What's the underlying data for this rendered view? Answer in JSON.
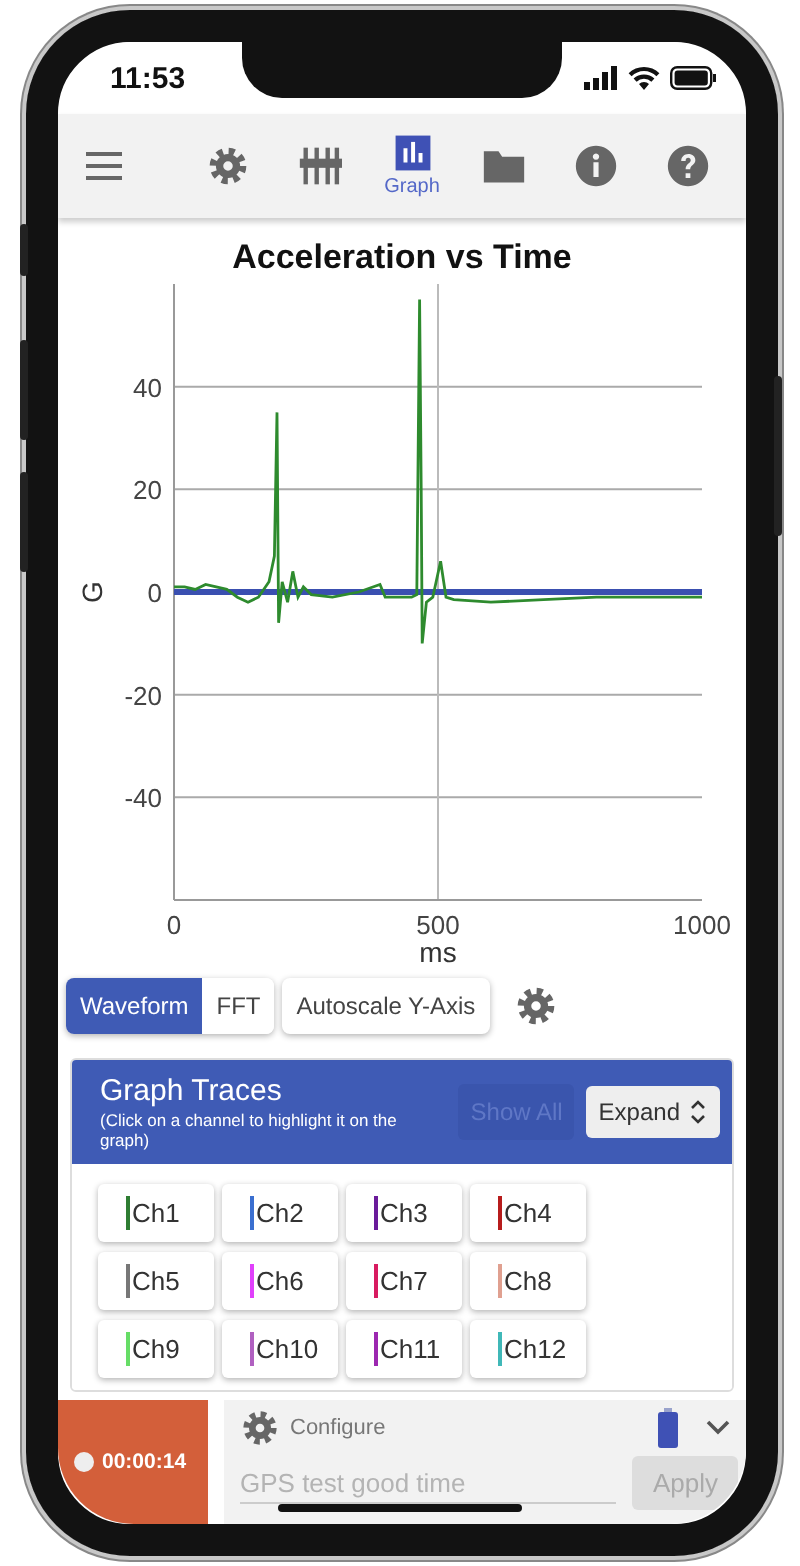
{
  "status_bar": {
    "time": "11:53"
  },
  "nav": {
    "items": [
      {
        "kind": "settings",
        "selected": false
      },
      {
        "kind": "mixer",
        "selected": false
      },
      {
        "kind": "graph",
        "label": "Graph",
        "selected": true
      },
      {
        "kind": "folder",
        "selected": false
      },
      {
        "kind": "info",
        "selected": false
      },
      {
        "kind": "help",
        "selected": false
      }
    ]
  },
  "chart": {
    "chart_data": {
      "type": "line",
      "grid": true,
      "title": "Acceleration vs Time",
      "xlabel": "ms",
      "ylabel": "G",
      "xlim": [
        0,
        1000
      ],
      "ylim": [
        -60,
        60
      ],
      "xticks": [
        0,
        500,
        1000
      ],
      "yticks": [
        -40,
        -20,
        0,
        20,
        40
      ],
      "ref_lines": [
        {
          "axis": "x",
          "value": 500
        }
      ],
      "x": [
        0,
        20,
        40,
        60,
        80,
        100,
        120,
        140,
        160,
        180,
        190,
        195,
        198,
        205,
        215,
        225,
        235,
        245,
        260,
        300,
        350,
        390,
        400,
        450,
        460,
        465,
        468,
        470,
        478,
        490,
        505,
        515,
        530,
        600,
        700,
        800,
        900,
        1000
      ],
      "series": [
        {
          "color": "#2e8b2e",
          "values": [
            1,
            1,
            0.5,
            1.5,
            1,
            0.5,
            -1,
            -2,
            -1,
            2,
            7,
            35,
            -6,
            2,
            -2,
            4,
            -1,
            1,
            -0.5,
            -1,
            0,
            1.5,
            -1,
            -1,
            -0.5,
            57,
            20,
            -10,
            -2,
            -1,
            6,
            -1,
            -1.5,
            -2,
            -1.5,
            -1,
            -1,
            -1
          ]
        },
        {
          "color": "#3a4fb0",
          "values": [
            0,
            0,
            0,
            0,
            0,
            0,
            0,
            0,
            0,
            0,
            0,
            0,
            0,
            0,
            0,
            0,
            0,
            0,
            0,
            0,
            0,
            0,
            0,
            0,
            0,
            0,
            0,
            0,
            0,
            0,
            0,
            0,
            0,
            0,
            0,
            0,
            0,
            0
          ]
        }
      ]
    }
  },
  "view_modes": [
    {
      "label": "Waveform",
      "selected": true
    },
    {
      "label": "FFT",
      "selected": false
    }
  ],
  "autoscale_button": {
    "label": "Autoscale Y-Axis"
  },
  "traces": {
    "title": "Graph Traces",
    "hint": "(Click on a channel to highlight it on the graph)",
    "show_all": {
      "label": "Show All",
      "disabled": true
    },
    "expand": {
      "label": "Expand"
    },
    "channels": [
      {
        "label": "Ch1",
        "color": "#2e7d32"
      },
      {
        "label": "Ch2",
        "color": "#3a6fd0"
      },
      {
        "label": "Ch3",
        "color": "#6a1b9a"
      },
      {
        "label": "Ch4",
        "color": "#b71c1c"
      },
      {
        "label": "Ch5",
        "color": "#777777"
      },
      {
        "label": "Ch6",
        "color": "#e040fb"
      },
      {
        "label": "Ch7",
        "color": "#d81b60"
      },
      {
        "label": "Ch8",
        "color": "#e0a090"
      },
      {
        "label": "Ch9",
        "color": "#66dd66"
      },
      {
        "label": "Ch10",
        "color": "#b060c0"
      },
      {
        "label": "Ch11",
        "color": "#9c27b0"
      },
      {
        "label": "Ch12",
        "color": "#40b8b8"
      }
    ]
  },
  "recorder": {
    "timer": "00:00:14",
    "recording": true
  },
  "configure": {
    "label": "Configure",
    "placeholder": "GPS test good time",
    "apply": {
      "label": "Apply",
      "disabled": true
    }
  }
}
